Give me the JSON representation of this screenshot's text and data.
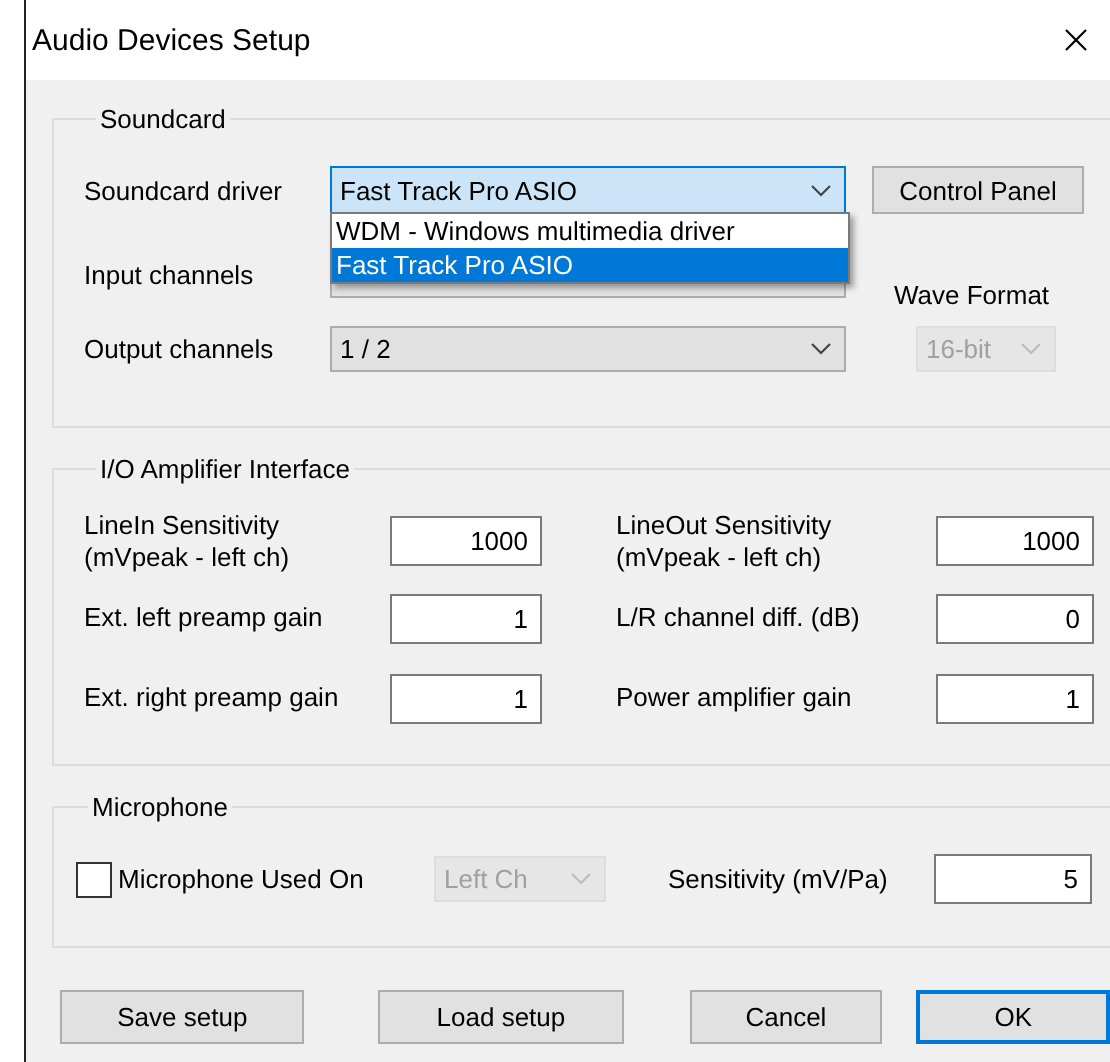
{
  "window": {
    "title": "Audio Devices Setup"
  },
  "soundcard": {
    "title": "Soundcard",
    "driver": {
      "label": "Soundcard driver",
      "value": "Fast Track Pro ASIO",
      "expanded": true,
      "options": [
        {
          "label": "WDM - Windows multimedia driver",
          "selected": false
        },
        {
          "label": "Fast Track Pro ASIO",
          "selected": true
        }
      ]
    },
    "control_panel": {
      "label": "Control Panel"
    },
    "input_channels": {
      "label": "Input channels"
    },
    "output_channels": {
      "label": "Output channels",
      "value": "1 / 2"
    },
    "wave_format": {
      "label": "Wave Format",
      "value": "16-bit",
      "disabled": true
    }
  },
  "io_amplifier": {
    "title": "I/O Amplifier Interface",
    "fields": [
      {
        "label": "LineIn Sensitivity\n(mVpeak - left ch)",
        "value": "1000"
      },
      {
        "label": "LineOut Sensitivity\n(mVpeak - left ch)",
        "value": "1000"
      },
      {
        "label": "Ext. left preamp gain",
        "value": "1"
      },
      {
        "label": "L/R channel diff. (dB)",
        "value": "0"
      },
      {
        "label": "Ext. right preamp gain",
        "value": "1"
      },
      {
        "label": "Power amplifier gain",
        "value": "1"
      }
    ]
  },
  "microphone": {
    "title": "Microphone",
    "used_on": {
      "label": "Microphone Used On",
      "checked": false
    },
    "channel": {
      "value": "Left Ch",
      "disabled": true
    },
    "sensitivity": {
      "label": "Sensitivity (mV/Pa)",
      "value": "5"
    }
  },
  "buttons": [
    {
      "label": "Save setup",
      "default": false
    },
    {
      "label": "Load setup",
      "default": false
    },
    {
      "label": "Cancel",
      "default": false
    },
    {
      "label": "OK",
      "default": true
    }
  ]
}
